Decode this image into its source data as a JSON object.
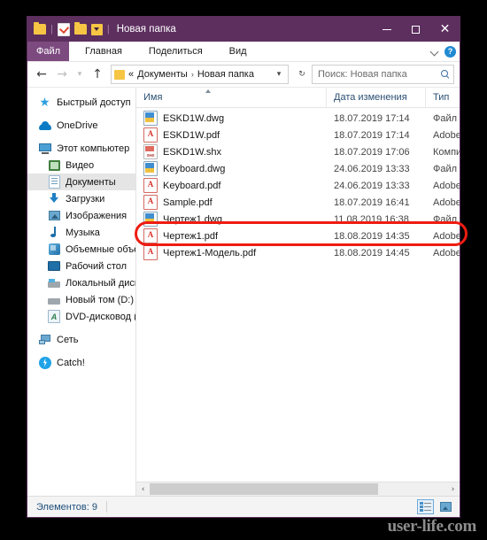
{
  "window": {
    "title": "Новая папка",
    "quick_access": {
      "folder_icon": "folder-icon",
      "properties_icon": "properties-icon",
      "new_folder_icon": "new-folder-icon",
      "customize_icon": "customize-quick-access-icon"
    },
    "buttons": {
      "minimize": "—",
      "maximize": "□",
      "close": "✕"
    },
    "accent_color": "#5d2f5f"
  },
  "ribbon": {
    "file_tab": "Файл",
    "tabs": [
      "Главная",
      "Поделиться",
      "Вид"
    ],
    "expand_icon": "chevron-down-icon",
    "help_label": "?"
  },
  "nav": {
    "back_icon": "back-arrow-icon",
    "forward_icon": "forward-arrow-icon",
    "recent_icon": "recent-locations-icon",
    "up_icon": "up-arrow-icon",
    "address": {
      "folder_icon": "folder-icon",
      "overflow": "«",
      "crumbs": [
        "Документы",
        "Новая папка"
      ],
      "separator": "›",
      "dropdown_icon": "▾",
      "refresh_icon": "↻"
    },
    "search": {
      "placeholder": "Поиск: Новая папка",
      "icon": "search-icon"
    }
  },
  "sidebar": {
    "items": [
      {
        "label": "Быстрый доступ",
        "icon": "pin-icon",
        "level": 0,
        "selected": false
      },
      {
        "label": "OneDrive",
        "icon": "cloud-icon",
        "level": 0,
        "selected": false
      },
      {
        "label": "Этот компьютер",
        "icon": "computer-icon",
        "level": 0,
        "selected": false
      },
      {
        "label": "Видео",
        "icon": "video-icon",
        "level": 1,
        "selected": false
      },
      {
        "label": "Документы",
        "icon": "documents-icon",
        "level": 1,
        "selected": true
      },
      {
        "label": "Загрузки",
        "icon": "downloads-icon",
        "level": 1,
        "selected": false
      },
      {
        "label": "Изображения",
        "icon": "pictures-icon",
        "level": 1,
        "selected": false
      },
      {
        "label": "Музыка",
        "icon": "music-icon",
        "level": 1,
        "selected": false
      },
      {
        "label": "Объемные объект",
        "icon": "3d-objects-icon",
        "level": 1,
        "selected": false
      },
      {
        "label": "Рабочий стол",
        "icon": "desktop-icon",
        "level": 1,
        "selected": false
      },
      {
        "label": "Локальный диск (С",
        "icon": "hard-drive-icon",
        "level": 1,
        "selected": false
      },
      {
        "label": "Новый том (D:)",
        "icon": "drive-icon",
        "level": 1,
        "selected": false
      },
      {
        "label": "DVD-дисковод (E:)",
        "icon": "dvd-drive-icon",
        "level": 1,
        "selected": false
      },
      {
        "label": "Сеть",
        "icon": "network-icon",
        "level": 0,
        "selected": false
      },
      {
        "label": "Catch!",
        "icon": "catch-icon",
        "level": 0,
        "selected": false
      }
    ]
  },
  "filelist": {
    "columns": {
      "name": "Имя",
      "date": "Дата изменения",
      "type": "Тип"
    },
    "sort_icon": "sort-ascending-icon",
    "rows": [
      {
        "name": "ESKD1W.dwg",
        "date": "18.07.2019 17:14",
        "type": "Файл \"D",
        "icon": "dwg",
        "highlighted": false
      },
      {
        "name": "ESKD1W.pdf",
        "date": "18.07.2019 17:14",
        "type": "Adobe A",
        "icon": "pdf",
        "highlighted": false
      },
      {
        "name": "ESKD1W.shx",
        "date": "18.07.2019 17:06",
        "type": "Компил",
        "icon": "shx",
        "highlighted": false
      },
      {
        "name": "Keyboard.dwg",
        "date": "24.06.2019 13:33",
        "type": "Файл \"D",
        "icon": "dwg",
        "highlighted": false
      },
      {
        "name": "Keyboard.pdf",
        "date": "24.06.2019 13:33",
        "type": "Adobe A",
        "icon": "pdf",
        "highlighted": false
      },
      {
        "name": "Sample.pdf",
        "date": "18.07.2019 16:41",
        "type": "Adobe A",
        "icon": "pdf",
        "highlighted": false
      },
      {
        "name": "Чертеж1.dwg",
        "date": "11.08.2019 16:38",
        "type": "Файл \"D",
        "icon": "dwg",
        "highlighted": false
      },
      {
        "name": "Чертеж1.pdf",
        "date": "18.08.2019 14:35",
        "type": "Adobe A",
        "icon": "pdf",
        "highlighted": false
      },
      {
        "name": "Чертеж1-Модель.pdf",
        "date": "18.08.2019 14:45",
        "type": "Adobe A",
        "icon": "pdf",
        "highlighted": true
      }
    ],
    "scroll_left_icon": "‹",
    "scroll_right_icon": "›"
  },
  "statusbar": {
    "count_text": "Элементов: 9",
    "view_details_icon": "details-view-icon",
    "view_large_icon": "large-icons-view-icon"
  },
  "annotation": {
    "color": "#ee1c12",
    "target": "Чертеж1-Модель.pdf"
  },
  "watermark": "user-life.com"
}
